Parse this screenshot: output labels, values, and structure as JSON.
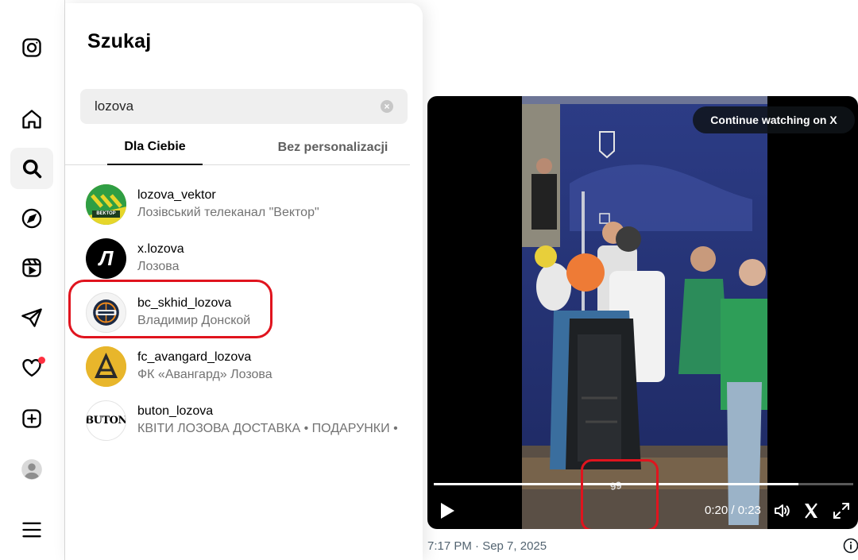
{
  "nav": {
    "items": [
      {
        "icon": "instagram-logo-icon"
      },
      {
        "icon": "home-icon"
      },
      {
        "icon": "search-icon",
        "active": true
      },
      {
        "icon": "explore-compass-icon"
      },
      {
        "icon": "reels-icon"
      },
      {
        "icon": "messages-send-icon"
      },
      {
        "icon": "notifications-heart-icon",
        "badge": true
      },
      {
        "icon": "create-plus-icon"
      },
      {
        "icon": "profile-avatar-icon"
      },
      {
        "icon": "more-menu-icon"
      }
    ]
  },
  "search": {
    "title": "Szukaj",
    "query": "lozova",
    "tabs": [
      {
        "label": "Dla Ciebie",
        "active": true
      },
      {
        "label": "Bez personalizacji",
        "active": false
      }
    ],
    "results": [
      {
        "username": "lozova_vektor",
        "subtitle": "Лозівський телеканал \"Вектор\"",
        "avatar_text": "ВЕКТОР"
      },
      {
        "username": "x.lozova",
        "subtitle": "Лозова",
        "avatar_text": "Л"
      },
      {
        "username": "bc_skhid_lozova",
        "subtitle": "Владимир Донской",
        "highlighted": true
      },
      {
        "username": "fc_avangard_lozova",
        "subtitle": "ФК «Авангард» Лозова"
      },
      {
        "username": "buton_lozova",
        "subtitle": "КВІТИ ЛОЗОВА ДОСТАВКА • ПОДАРУНКИ • П",
        "avatar_text": "BUTON"
      }
    ]
  },
  "embed": {
    "stray_char": "i",
    "continue_label": "Continue watching on X",
    "time": "0:20 / 0:23",
    "progress": 0.87,
    "jersey_number": "99",
    "timestamp": "7:17 PM · Sep 7, 2025"
  },
  "colors": {
    "highlight": "#e0141e",
    "badge": "#ff3040",
    "muted_text": "#737373"
  }
}
